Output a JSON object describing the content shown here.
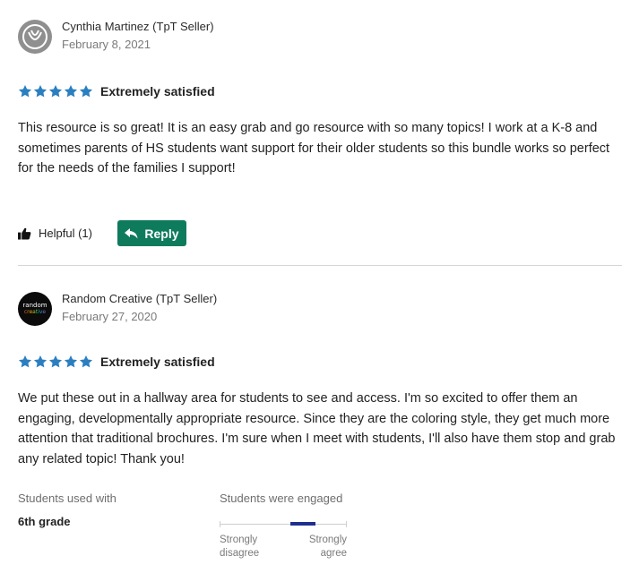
{
  "reviews": [
    {
      "author": "Cynthia Martinez",
      "author_role": "(TpT Seller)",
      "date": "February 8, 2021",
      "stars": 5,
      "rating_label": "Extremely satisfied",
      "body": "This resource is so great! It is an easy grab and go resource with so many topics! I work at a K-8 and sometimes parents of HS students want support for their older students so this bundle works so perfect for the needs of the families I support!",
      "helpful_label": "Helpful (1)",
      "reply_label": "Reply"
    },
    {
      "author": "Random Creative",
      "author_role": "(TpT Seller)",
      "date": "February 27, 2020",
      "stars": 5,
      "rating_label": "Extremely satisfied",
      "avatar_text": [
        "random",
        "creative"
      ],
      "body": "We put these out in a hallway area for students to see and access.  I'm so excited to offer them an engaging, developmentally appropriate resource.  Since they are the coloring style, they get much more attention that traditional brochures.  I'm sure when I meet with students, I'll also have them stop and grab any related topic!  Thank you!",
      "survey": {
        "used_with_heading": "Students used with",
        "used_with_value": "6th grade",
        "engaged_heading": "Students were engaged",
        "engaged_level": 0.75,
        "scale_low_label": "Strongly disagree",
        "scale_high_label": "Strongly agree"
      }
    }
  ],
  "colors": {
    "star": "#2b7fc0",
    "reply_button": "#0f7b5d",
    "scale_fill": "#1f2f8f"
  }
}
